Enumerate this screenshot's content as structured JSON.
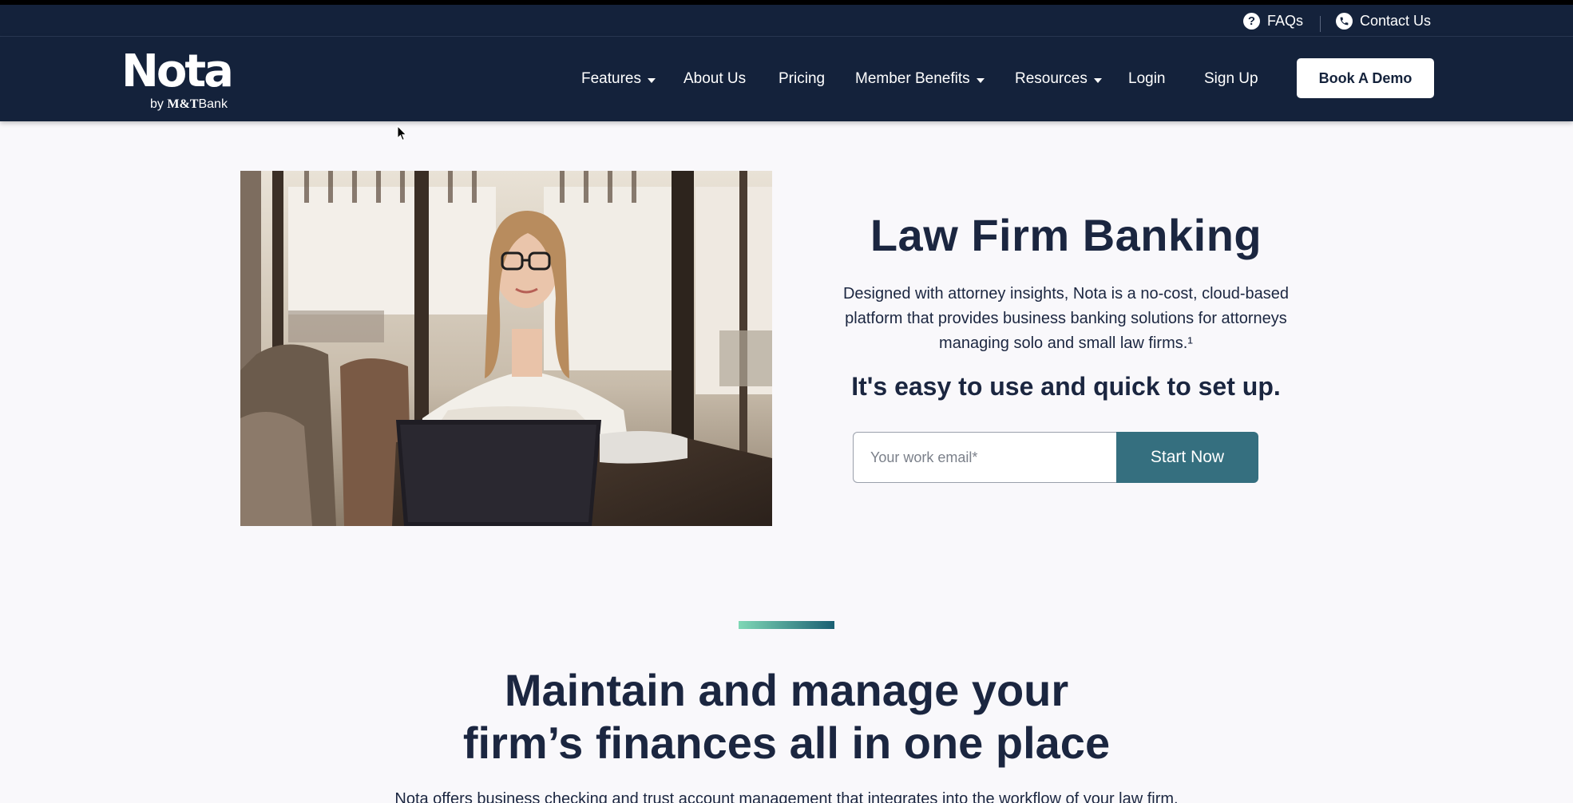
{
  "utility_bar": {
    "faqs_label": "FAQs",
    "contact_label": "Contact Us"
  },
  "logo": {
    "word": "Nota",
    "by": "by",
    "brand": "M&T",
    "brand_suffix": "Bank"
  },
  "nav": {
    "features": "Features",
    "about": "About Us",
    "pricing": "Pricing",
    "member_benefits": "Member Benefits",
    "resources": "Resources",
    "login": "Login",
    "signup": "Sign Up",
    "book_demo": "Book A Demo"
  },
  "hero": {
    "title": "Law Firm Banking",
    "description": "Designed with attorney insights, Nota is a no-cost, cloud-based platform that provides business banking solutions for attorneys managing solo and small law firms.¹",
    "subtitle": "It's easy to use and quick to set up.",
    "email_placeholder": "Your work email*",
    "email_value": "",
    "start_button": "Start Now"
  },
  "section": {
    "title_line1": "Maintain and manage your",
    "title_line2": "firm’s finances all in one place",
    "body": "Nota offers business checking and trust account management that integrates into the workflow of your law firm."
  },
  "colors": {
    "navy": "#14223b",
    "teal_button": "#356f7f",
    "accent_start": "#7fd8b5",
    "accent_end": "#1a5f73"
  },
  "icons": {
    "faq": "question-circle-icon",
    "contact": "phone-circle-icon",
    "dropdown": "caret-down-icon"
  }
}
